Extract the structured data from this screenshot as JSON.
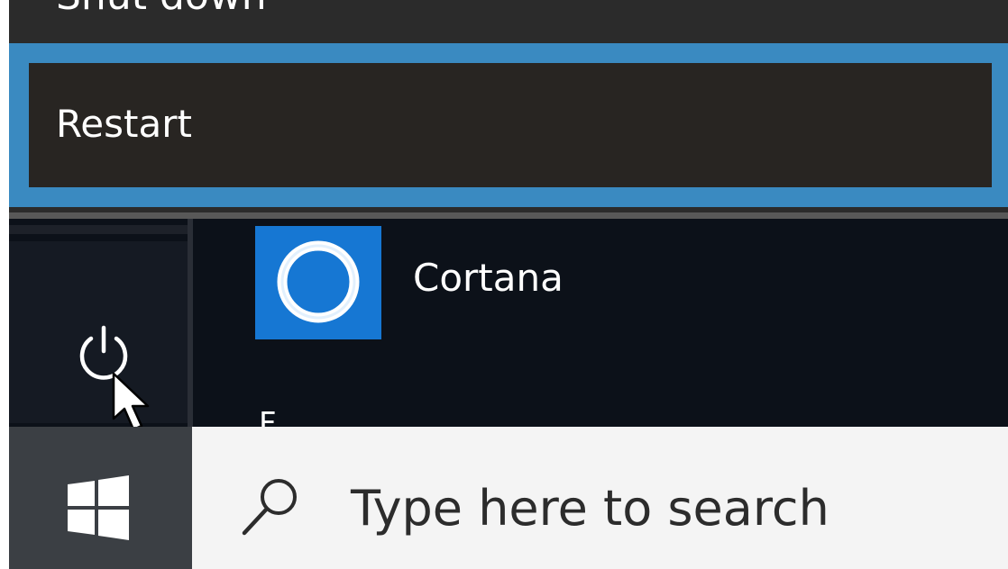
{
  "power_menu": {
    "items": [
      {
        "label": "Shut down"
      },
      {
        "label": "Restart"
      }
    ]
  },
  "start_menu": {
    "apps": [
      {
        "label": "Cortana",
        "icon": "cortana-icon"
      }
    ],
    "next_section_letter": "F"
  },
  "taskbar": {
    "search": {
      "placeholder": "Type here to search",
      "icon": "search-icon"
    },
    "start_icon": "windows-logo-icon"
  },
  "colors": {
    "accent": "#3a8ac1",
    "tile": "#1677d3",
    "menu_bg": "#2b2b2b",
    "start_bg": "#0c1119"
  }
}
